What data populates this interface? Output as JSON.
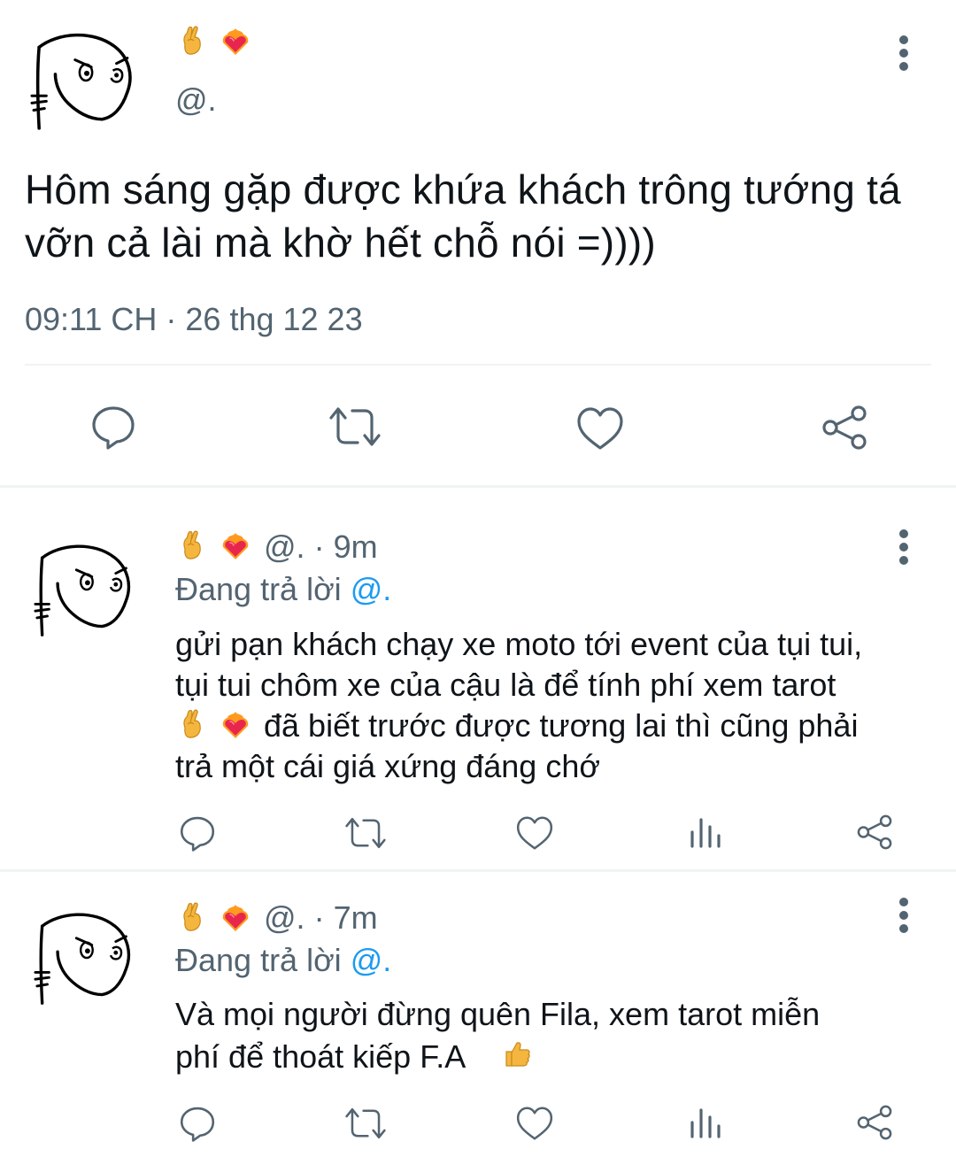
{
  "main_tweet": {
    "display_name_emojis": [
      "crossed-fingers",
      "heart-on-fire"
    ],
    "handle": "@.",
    "text": "Hôm sáng gặp được khứa khách trông tướng tá vỡn cả lài mà khờ hết chỗ nói =))))",
    "timestamp": "09:11 CH · 26 thg 12 23",
    "actions": [
      "reply-icon",
      "retweet-icon",
      "like-icon",
      "share-icon"
    ]
  },
  "replies": [
    {
      "display_name_emojis": [
        "crossed-fingers",
        "heart-on-fire"
      ],
      "handle": "@.",
      "separator": "·",
      "time": "9m",
      "replying_prefix": "Đang trả lời",
      "replying_to": "@.",
      "text_line1": "gửi pạn khách chạy xe moto tới event của tụi tui,",
      "text_line2": "tụi tui chôm xe của cậu là để tính phí xem tarot",
      "text_line3": "đã biết trước được tương lai thì cũng phải",
      "text_line4": "trả một cái giá xứng đáng chớ",
      "actions": [
        "reply-icon",
        "retweet-icon",
        "like-icon",
        "views-icon",
        "share-icon"
      ]
    },
    {
      "display_name_emojis": [
        "crossed-fingers",
        "heart-on-fire"
      ],
      "handle": "@.",
      "separator": "·",
      "time": "7m",
      "replying_prefix": "Đang trả lời",
      "replying_to": "@.",
      "text_line1": "Và mọi người đừng quên Fila, xem tarot miễn",
      "text_line2": "phí để thoát kiếp F.A",
      "trailing_emoji": "thumbs-up",
      "actions": [
        "reply-icon",
        "retweet-icon",
        "like-icon",
        "views-icon",
        "share-icon"
      ]
    }
  ],
  "colors": {
    "text": "#0f1419",
    "muted": "#536471",
    "link": "#1d9bf0",
    "divider": "#eff3f4"
  }
}
